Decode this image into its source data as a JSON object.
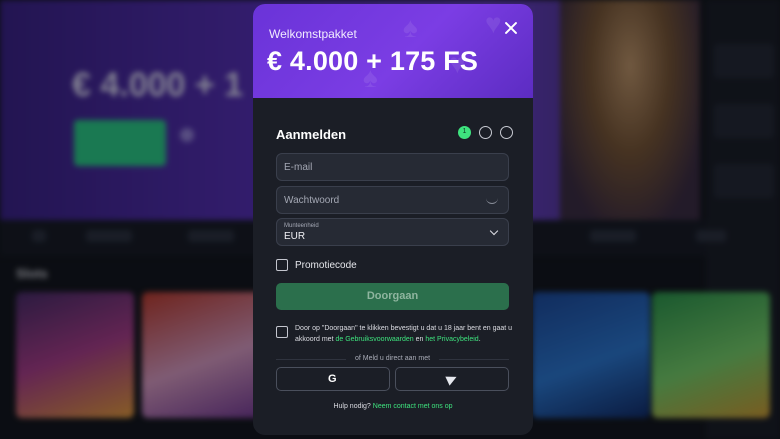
{
  "background": {
    "hero_amount": "€ 4.000 + 1",
    "section_title": "Slots"
  },
  "modal": {
    "subtitle": "Welkomstpakket",
    "title": "€ 4.000 + 175 FS",
    "form_title": "Aanmelden",
    "steps": [
      "1",
      "",
      ""
    ],
    "email_placeholder": "E-mail",
    "password_placeholder": "Wachtwoord",
    "currency_label": "Munteenheid",
    "currency_value": "EUR",
    "promo_label": "Promotiecode",
    "submit_label": "Doorgaan",
    "terms_prefix": "Door op \"Doorgaan\" te klikken bevestigt u dat u 18 jaar bent en gaat u akkoord met ",
    "terms_link": "de Gebruiksvoorwaarden",
    "terms_mid": " en ",
    "privacy_link": "het Privacybeleid",
    "terms_end": ".",
    "or_text": "of Meld u direct aan met",
    "google_glyph": "G",
    "help_text": "Hulp nodig? ",
    "help_link": "Neem contact met ons op"
  },
  "colors": {
    "accent": "#3ee37e",
    "header_purple": "#7b3de4",
    "button_green": "#2b6f4c"
  }
}
